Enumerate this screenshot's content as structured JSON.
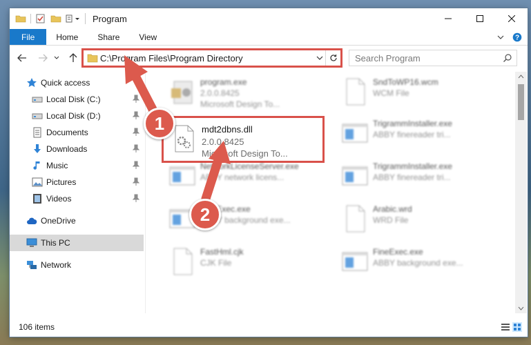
{
  "window": {
    "title": "Program",
    "ribbon_tabs": [
      "File",
      "Home",
      "Share",
      "View"
    ]
  },
  "address": {
    "path": "C:\\Program Files\\Program Directory"
  },
  "search": {
    "placeholder": "Search Program"
  },
  "nav": {
    "items": [
      {
        "label": "Quick access",
        "icon": "star-icon"
      },
      {
        "label": "Local Disk (C:)",
        "icon": "drive-icon",
        "pinned": true
      },
      {
        "label": "Local Disk (D:)",
        "icon": "drive-icon",
        "pinned": true
      },
      {
        "label": "Documents",
        "icon": "documents-icon",
        "pinned": true
      },
      {
        "label": "Downloads",
        "icon": "download-icon",
        "pinned": true
      },
      {
        "label": "Music",
        "icon": "music-icon",
        "pinned": true
      },
      {
        "label": "Pictures",
        "icon": "pictures-icon",
        "pinned": true
      },
      {
        "label": "Videos",
        "icon": "videos-icon",
        "pinned": true
      },
      {
        "label": "OneDrive",
        "icon": "cloud-icon"
      },
      {
        "label": "This PC",
        "icon": "pc-icon",
        "selected": true
      },
      {
        "label": "Network",
        "icon": "network-icon"
      }
    ]
  },
  "files": [
    {
      "name": "program.exe",
      "line1": "2.0.0.8425",
      "line2": "Microsoft Design To...",
      "kind": "exe-icon"
    },
    {
      "name": "SndToWP16.wcm",
      "line1": "WCM File",
      "line2": "",
      "kind": "blank-file-icon"
    },
    {
      "name": "mdt2dbns.dll",
      "line1": "2.0.0.8425",
      "line2": "Microsoft Design To...",
      "kind": "dll-icon"
    },
    {
      "name": "TrigrammInstaller.exe",
      "line1": "ABBY finereader tri...",
      "line2": "",
      "kind": "app-window-icon"
    },
    {
      "name": "NetworkLicenseServer.exe",
      "line1": "ABBY network licens...",
      "line2": "",
      "kind": "app-window-icon"
    },
    {
      "name": "TrigrammInstaller.exe",
      "line1": "ABBY finereader tri...",
      "line2": "",
      "kind": "app-window-icon"
    },
    {
      "name": "FineExec.exe",
      "line1": "ABBY background exe...",
      "line2": "",
      "kind": "app-window-icon"
    },
    {
      "name": "Arabic.wrd",
      "line1": "WRD File",
      "line2": "",
      "kind": "blank-file-icon"
    },
    {
      "name": "FastHml.cjk",
      "line1": "CJK File",
      "line2": "",
      "kind": "blank-file-icon"
    },
    {
      "name": "FineExec.exe",
      "line1": "ABBY background exe...",
      "line2": "",
      "kind": "app-window-icon"
    }
  ],
  "status": {
    "count": "106 items"
  },
  "annotations": {
    "step1": "1",
    "step2": "2",
    "color": "#dc5a4d"
  }
}
